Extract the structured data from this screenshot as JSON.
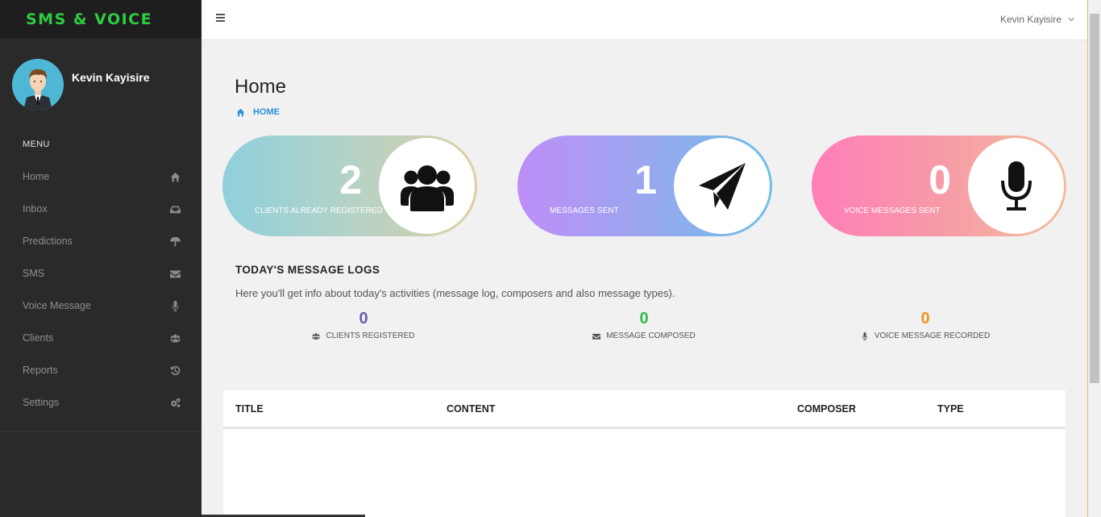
{
  "brand": {
    "title": "SMS & VOICE",
    "color": "#2ecc40"
  },
  "profile": {
    "name": "Kevin Kayisire"
  },
  "sidebar": {
    "menu_label": "MENU",
    "items": [
      {
        "label": "Home",
        "icon": "home-icon"
      },
      {
        "label": "Inbox",
        "icon": "inbox-icon"
      },
      {
        "label": "Predictions",
        "icon": "umbrella-icon"
      },
      {
        "label": "SMS",
        "icon": "envelope-icon"
      },
      {
        "label": "Voice Message",
        "icon": "microphone-icon"
      },
      {
        "label": "Clients",
        "icon": "users-icon"
      },
      {
        "label": "Reports",
        "icon": "history-icon"
      },
      {
        "label": "Settings",
        "icon": "gears-icon"
      }
    ]
  },
  "topbar": {
    "user_name": "Kevin Kayisire"
  },
  "page": {
    "title": "Home",
    "breadcrumb": "HOME"
  },
  "stats": [
    {
      "value": "2",
      "label": "CLIENTS ALREADY REGISTERED",
      "icon": "users-icon"
    },
    {
      "value": "1",
      "label": "MESSAGES SENT",
      "icon": "paper-plane-icon"
    },
    {
      "value": "0",
      "label": "VOICE MESSAGES SENT",
      "icon": "microphone-icon"
    }
  ],
  "logs": {
    "title": "TODAY'S MESSAGE LOGS",
    "description": "Here you'll get info about today's activities (message log, composers and also message types).",
    "items": [
      {
        "value": "0",
        "label": "CLIENTS REGISTERED",
        "color": "#6a5aae"
      },
      {
        "value": "0",
        "label": "MESSAGE COMPOSED",
        "color": "#2ebd4a"
      },
      {
        "value": "0",
        "label": "VOICE MESSAGE RECORDED",
        "color": "#f0931e"
      }
    ]
  },
  "table": {
    "columns": [
      "TITLE",
      "CONTENT",
      "COMPOSER",
      "TYPE"
    ]
  }
}
